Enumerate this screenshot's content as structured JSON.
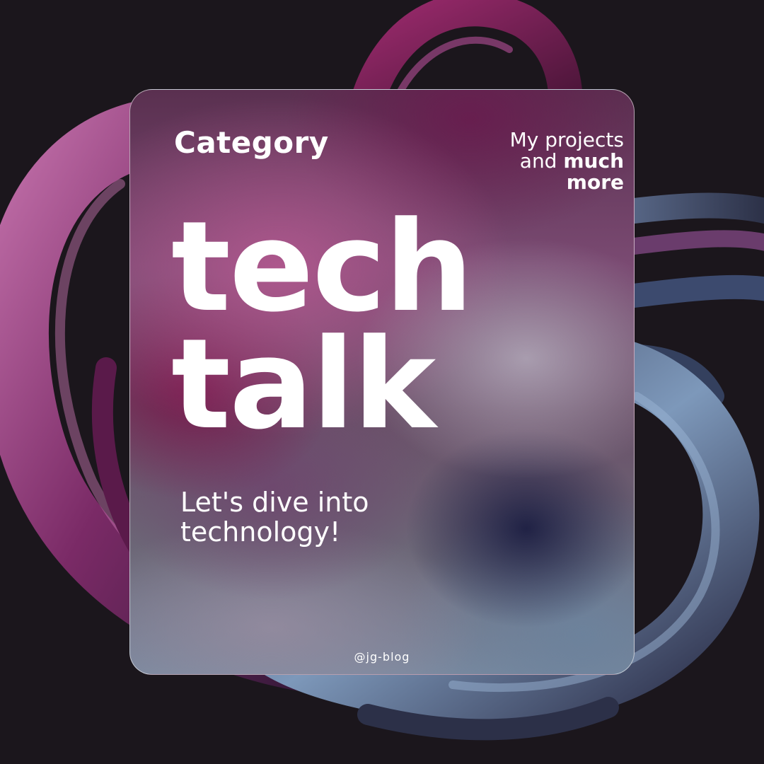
{
  "colors": {
    "background": "#1b161c",
    "magenta": "#b0587f",
    "deep_magenta": "#781648",
    "steel_blue": "#6c82a0",
    "text": "#ffffff"
  },
  "card": {
    "category": "Category",
    "tagline": {
      "line1": "My projects",
      "line2_prefix": "and ",
      "line2_bold": "much",
      "line3_bold": "more"
    },
    "headline": {
      "line1": "tech",
      "line2": "talk"
    },
    "subtitle": {
      "line1": "Let's dive into",
      "line2": "technology!"
    },
    "handle": "@jg-blog"
  }
}
